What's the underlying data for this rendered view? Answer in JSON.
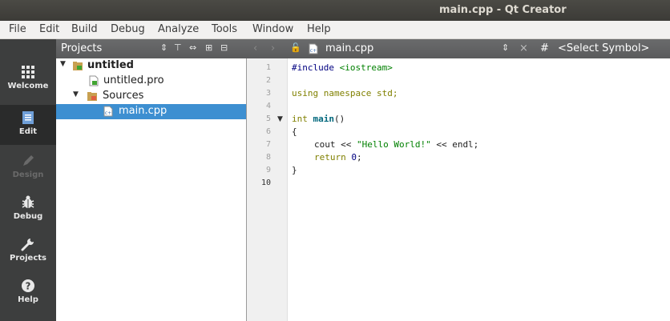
{
  "window": {
    "title": "main.cpp - Qt Creator"
  },
  "menu": [
    {
      "label": "File"
    },
    {
      "label": "Edit"
    },
    {
      "label": "Build"
    },
    {
      "label": "Debug"
    },
    {
      "label": "Analyze"
    },
    {
      "label": "Tools"
    },
    {
      "label": "Window"
    },
    {
      "label": "Help"
    }
  ],
  "sidebar": {
    "items": [
      {
        "label": "Welcome",
        "icon": "grid-icon"
      },
      {
        "label": "Edit",
        "icon": "document-icon"
      },
      {
        "label": "Design",
        "icon": "pencil-icon"
      },
      {
        "label": "Debug",
        "icon": "bug-icon"
      },
      {
        "label": "Projects",
        "icon": "wrench-icon"
      },
      {
        "label": "Help",
        "icon": "question-icon"
      }
    ]
  },
  "projects_panel": {
    "title": "Projects",
    "tree": [
      {
        "label": "untitled"
      },
      {
        "label": "untitled.pro"
      },
      {
        "label": "Sources"
      },
      {
        "label": "main.cpp"
      }
    ]
  },
  "editor": {
    "file_tab": "main.cpp",
    "symbol": "<Select Symbol>",
    "hash": "#",
    "line_numbers": [
      "1",
      "2",
      "3",
      "4",
      "5",
      "6",
      "7",
      "8",
      "9",
      "10"
    ],
    "code": {
      "l1_pre": "#include",
      "l1_inc": "<iostream>",
      "l3_a": "using",
      "l3_b": "namespace",
      "l3_c": "std;",
      "l5_type": "int",
      "l5_fn": "main",
      "l5_rest": "()",
      "l6": "{",
      "l7_a": "cout << ",
      "l7_str": "\"Hello World!\"",
      "l7_b": " << endl;",
      "l8_kw": "return",
      "l8_num": "0",
      "l8_end": ";",
      "l9": "}"
    }
  },
  "colors": {
    "selection": "#3d8fd1",
    "sidebar": "#3d3e3e",
    "titlebar": "#3c3b37"
  }
}
